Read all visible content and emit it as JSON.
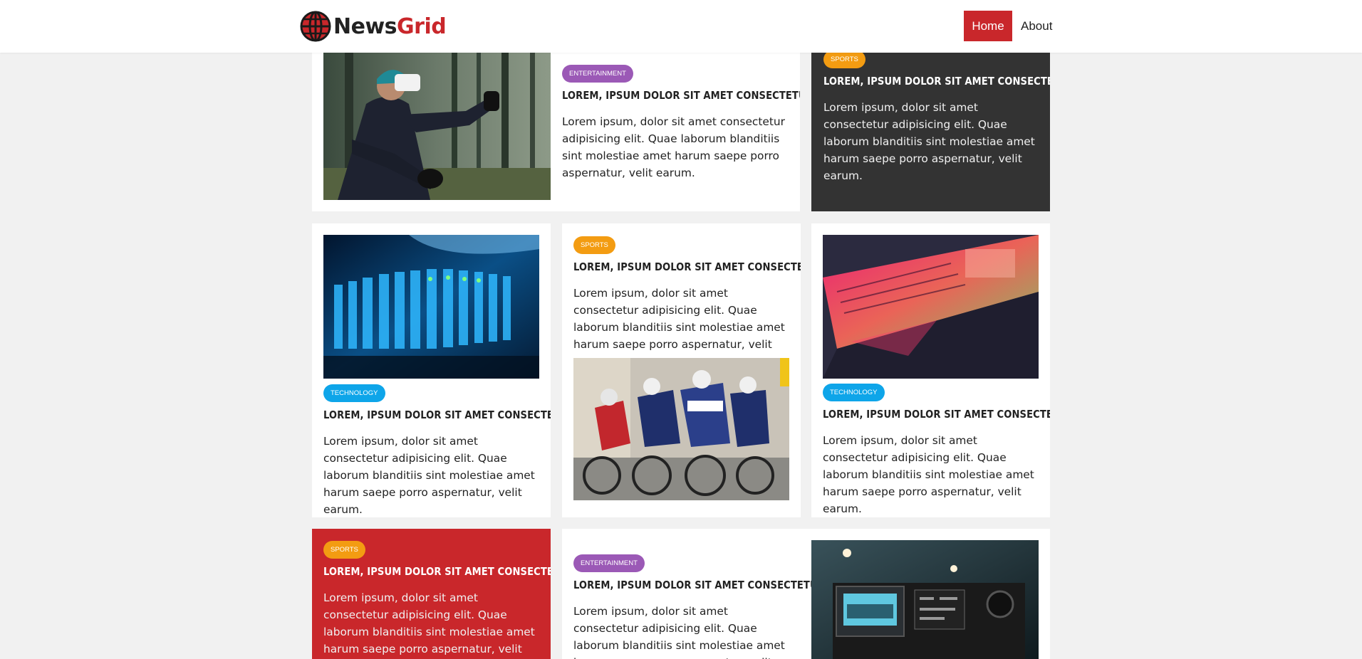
{
  "header": {
    "logo_news": "News",
    "logo_grid": "Grid",
    "nav": {
      "home": "Home",
      "about": "About"
    }
  },
  "colors": {
    "accent": "#c9272b",
    "entertainment": "#9b59b6",
    "sports": "#f39c12",
    "technology": "#0ea5e9",
    "dark_card": "#333333"
  },
  "articles": [
    {
      "category": "ENTERTAINMENT",
      "title": "Lorem, ipsum dolor sit amet consectetur",
      "body": "Lorem ipsum, dolor sit amet consectetur adipisicing elit. Quae laborum blanditiis sint molestiae amet harum saepe porro aspernatur, velit earum.",
      "image": "vr-headset-forest"
    },
    {
      "category": "SPORTS",
      "title": "Lorem, ipsum dolor sit amet consectetur",
      "body": "Lorem ipsum, dolor sit amet consectetur adipisicing elit. Quae laborum blanditiis sint molestiae amet harum saepe porro aspernatur, velit earum."
    },
    {
      "category": "TECHNOLOGY",
      "title": "Lorem, ipsum dolor sit amet consectetur",
      "body": "Lorem ipsum, dolor sit amet consectetur adipisicing elit. Quae laborum blanditiis sint molestiae amet harum saepe porro aspernatur, velit earum.",
      "image": "server-rack"
    },
    {
      "category": "SPORTS",
      "title": "Lorem, ipsum dolor sit amet consectetur",
      "body": "Lorem ipsum, dolor sit amet consectetur adipisicing elit. Quae laborum blanditiis sint molestiae amet harum saepe porro aspernatur, velit earum.",
      "image": "cyclists"
    },
    {
      "category": "TECHNOLOGY",
      "title": "Lorem, ipsum dolor sit amet consectetur",
      "body": "Lorem ipsum, dolor sit amet consectetur adipisicing elit. Quae laborum blanditiis sint molestiae amet harum saepe porro aspernatur, velit earum.",
      "image": "laptop-neon"
    },
    {
      "category": "SPORTS",
      "title": "Lorem, ipsum dolor sit amet consectetur",
      "body": "Lorem ipsum, dolor sit amet consectetur adipisicing elit. Quae laborum blanditiis sint molestiae amet harum saepe porro aspernatur, velit earum."
    },
    {
      "category": "ENTERTAINMENT",
      "title": "Lorem, ipsum dolor sit amet consectetur",
      "body": "Lorem ipsum, dolor sit amet consectetur adipisicing elit. Quae laborum blanditiis sint molestiae amet harum saepe porro aspernatur, velit earum."
    },
    {
      "image": "video-camera"
    }
  ]
}
